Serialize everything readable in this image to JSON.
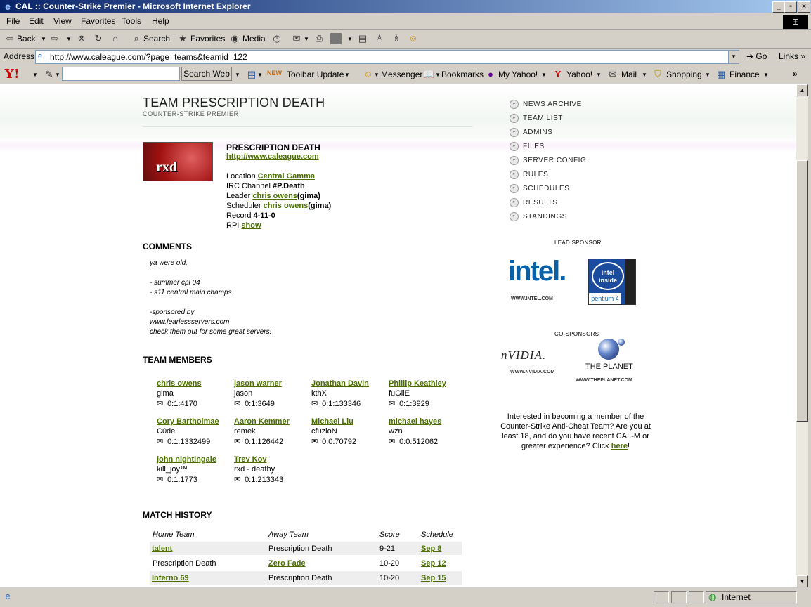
{
  "window": {
    "title": "CAL :: Counter-Strike Premier - Microsoft Internet Explorer"
  },
  "menu": [
    "File",
    "Edit",
    "View",
    "Favorites",
    "Tools",
    "Help"
  ],
  "toolbar": {
    "back": "Back",
    "search": "Search",
    "favorites": "Favorites",
    "media": "Media"
  },
  "address": {
    "label": "Address",
    "url": "http://www.caleague.com/?page=teams&teamid=122",
    "go": "Go",
    "links": "Links"
  },
  "yahoo": {
    "logo": "Y!",
    "search_button": "Search Web",
    "new_badge": "NEW",
    "toolbar_update": "Toolbar Update",
    "messenger": "Messenger",
    "bookmarks": "Bookmarks",
    "my_yahoo": "My Yahoo!",
    "yahoo": "Yahoo!",
    "mail": "Mail",
    "shopping": "Shopping",
    "finance": "Finance"
  },
  "team": {
    "title": "TEAM PRESCRIPTION DEATH",
    "subtitle": "COUNTER-STRIKE PREMIER",
    "logo_text": "rxd",
    "name": "PRESCRIPTION DEATH",
    "website": "http://www.caleague.com",
    "location_label": "Location",
    "location": "Central Gamma",
    "irc_label": "IRC Channel",
    "irc": "#P.Death",
    "leader_label": "Leader",
    "leader": "chris owens",
    "leader_nick": "(gima)",
    "scheduler_label": "Scheduler",
    "scheduler": "chris owens",
    "scheduler_nick": "(gima)",
    "record_label": "Record",
    "record": "4-11-0",
    "rpi_label": "RPI",
    "rpi_link": "show"
  },
  "comments": {
    "heading": "COMMENTS",
    "lines": [
      "ya were old.",
      "- summer cpl 04",
      "- s11 central main champs",
      "-sponsored by",
      "www.fearlessservers.com",
      "check them out for some great servers!"
    ]
  },
  "members": {
    "heading": "TEAM MEMBERS",
    "list": [
      {
        "name": "chris owens",
        "nick": "gima",
        "id": "0:1:4170"
      },
      {
        "name": "jason warner",
        "nick": "jason",
        "id": "0:1:3649"
      },
      {
        "name": "Jonathan Davin",
        "nick": "kthX",
        "id": "0:1:133346"
      },
      {
        "name": "Phillip Keathley",
        "nick": "fuGliE",
        "id": "0:1:3929"
      },
      {
        "name": "Cory Bartholmae",
        "nick": "C0de",
        "id": "0:1:1332499"
      },
      {
        "name": "Aaron Kemmer",
        "nick": "remek",
        "id": "0:1:126442"
      },
      {
        "name": "Michael Liu",
        "nick": "cfuzioN",
        "id": "0:0:70792"
      },
      {
        "name": "michael hayes",
        "nick": "wzn",
        "id": "0:0:512062"
      },
      {
        "name": "john nightingale",
        "nick": "kill_joy™",
        "id": "0:1:1773"
      },
      {
        "name": "Trev Kov",
        "nick": "rxd - deathy",
        "id": "0:1:213343"
      }
    ]
  },
  "matches": {
    "heading": "MATCH HISTORY",
    "headers": [
      "Home Team",
      "Away Team",
      "Score",
      "Schedule"
    ],
    "rows": [
      {
        "home": "talent",
        "away": "Prescription Death",
        "score": "9-21",
        "date": "Sep 8"
      },
      {
        "home": "Prescription Death",
        "away": "Zero Fade",
        "score": "10-20",
        "date": "Sep 12"
      },
      {
        "home": "Inferno 69",
        "away": "Prescription Death",
        "score": "10-20",
        "date": "Sep 15"
      }
    ]
  },
  "nav": [
    "NEWS ARCHIVE",
    "TEAM LIST",
    "ADMINS",
    "FILES",
    "SERVER CONFIG",
    "RULES",
    "SCHEDULES",
    "RESULTS",
    "STANDINGS"
  ],
  "sponsors": {
    "lead_label": "LEAD SPONSOR",
    "intel": "intel.",
    "intel_url": "WWW.INTEL.COM",
    "intel_inside": "intel inside",
    "pentium": "pentium 4",
    "co_label": "CO-SPONSORS",
    "nvidia": "nVIDIA.",
    "nvidia_url": "WWW.NVIDIA.COM",
    "planet": "THE PLANET",
    "planet_url": "WWW.THEPLANET.COM"
  },
  "promo": {
    "text": "Interested in becoming a member of the Counter-Strike Anti-Cheat Team? Are you at least 18, and do you have recent CAL-M or greater experience? Click ",
    "link": "here",
    "end": "!"
  },
  "status": {
    "zone": "Internet"
  }
}
